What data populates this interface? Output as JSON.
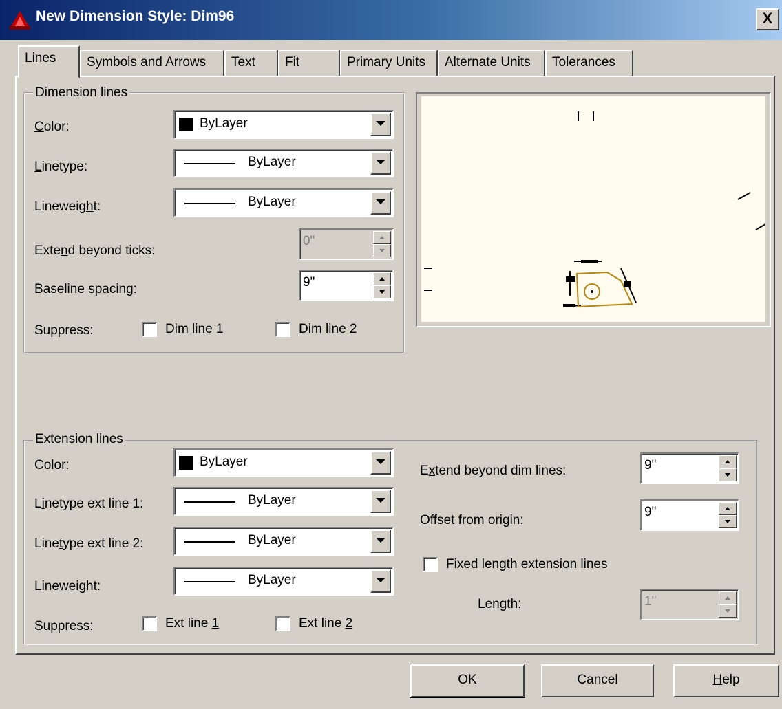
{
  "window": {
    "title": "New Dimension Style: Dim96",
    "close_label": "X"
  },
  "tabs": [
    {
      "label": "Lines"
    },
    {
      "label": "Symbols and Arrows"
    },
    {
      "label": "Text"
    },
    {
      "label": "Fit"
    },
    {
      "label": "Primary Units"
    },
    {
      "label": "Alternate Units"
    },
    {
      "label": "Tolerances"
    }
  ],
  "dimension_lines": {
    "legend": "Dimension lines",
    "color": {
      "label_pre": "",
      "label_key": "C",
      "label_post": "olor:",
      "value": "ByLayer"
    },
    "linetype": {
      "label_pre": "",
      "label_key": "L",
      "label_post": "inetype:",
      "value": "ByLayer"
    },
    "lineweight": {
      "label_pre": "Lineweig",
      "label_key": "h",
      "label_post": "t:",
      "value": "ByLayer"
    },
    "extend_beyond_ticks": {
      "label_pre": "Exte",
      "label_key": "n",
      "label_post": "d beyond ticks:",
      "value": "0\""
    },
    "baseline_spacing": {
      "label_pre": "B",
      "label_key": "a",
      "label_post": "seline spacing:",
      "value": "9\""
    },
    "suppress_label": "Suppress:",
    "dim_line_1": {
      "label_pre": "Di",
      "label_key": "m",
      "label_post": " line 1",
      "checked": false
    },
    "dim_line_2": {
      "label_pre": "",
      "label_key": "D",
      "label_post": "im line 2",
      "checked": false
    }
  },
  "extension_lines": {
    "legend": "Extension lines",
    "color": {
      "label_pre": "Colo",
      "label_key": "r",
      "label_post": ":",
      "value": "ByLayer"
    },
    "linetype_ext1": {
      "label_pre": "L",
      "label_key": "i",
      "label_post": "netype ext line 1:",
      "value": "ByLayer"
    },
    "linetype_ext2": {
      "label_pre": "Line",
      "label_key": "t",
      "label_post": "ype ext line 2:",
      "value": "ByLayer"
    },
    "lineweight": {
      "label_pre": "Line",
      "label_key": "w",
      "label_post": "eight:",
      "value": "ByLayer"
    },
    "suppress_label": "Suppress:",
    "ext_line_1": {
      "label_pre": "Ext line ",
      "label_key": "1",
      "label_post": "",
      "checked": false
    },
    "ext_line_2": {
      "label_pre": "Ext line ",
      "label_key": "2",
      "label_post": "",
      "checked": false
    },
    "extend_beyond_dim": {
      "label_pre": "E",
      "label_key": "x",
      "label_post": "tend beyond dim lines:",
      "value": "9\""
    },
    "offset_from_origin": {
      "label_pre": "",
      "label_key": "O",
      "label_post": "ffset from origin:",
      "value": "9\""
    },
    "fixed_length": {
      "label_pre": "Fixed length extensi",
      "label_key": "o",
      "label_post": "n lines",
      "checked": false
    },
    "length": {
      "label_pre": "L",
      "label_key": "e",
      "label_post": "ngth:",
      "value": "1\""
    }
  },
  "buttons": {
    "ok": "OK",
    "cancel": "Cancel",
    "help_pre": "",
    "help_key": "H",
    "help_post": "elp"
  }
}
